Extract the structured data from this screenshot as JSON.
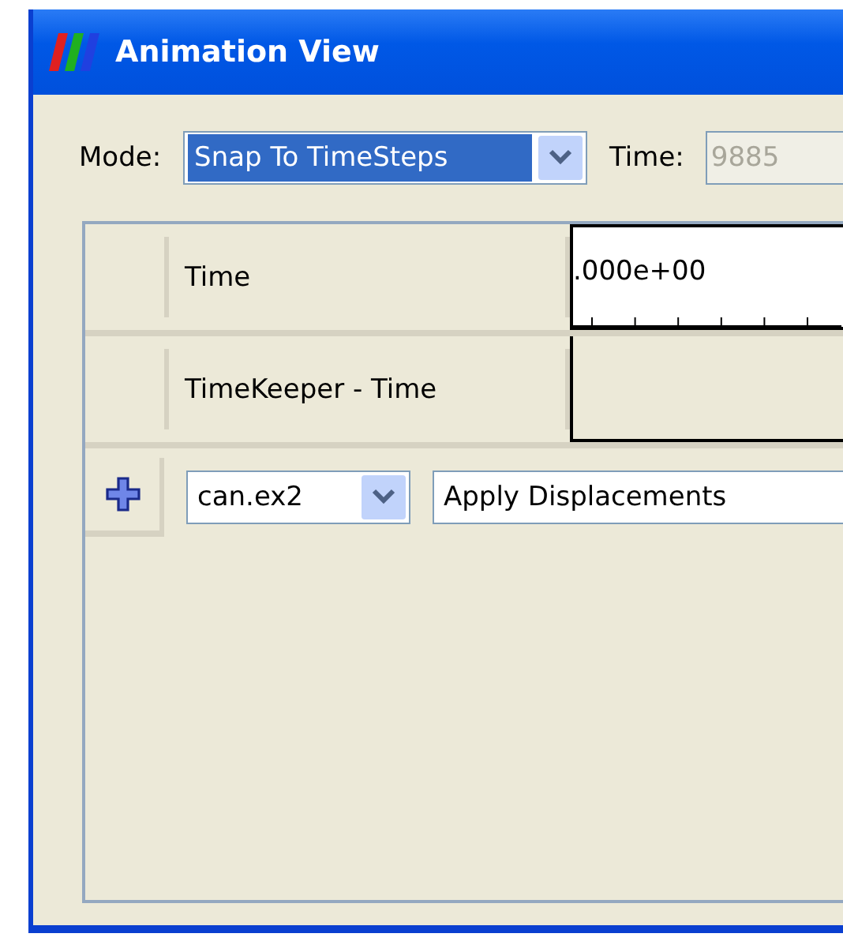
{
  "window": {
    "title": "Animation View"
  },
  "toolbar": {
    "mode_label": "Mode:",
    "mode": {
      "value": "Snap To TimeSteps",
      "selected": true
    },
    "time_label": "Time:",
    "time": {
      "value": "9885",
      "disabled": true
    }
  },
  "tracks": [
    {
      "kind": "time",
      "label": "Time",
      "value": ".000e+00"
    },
    {
      "kind": "keeper",
      "label": "TimeKeeper - Time"
    }
  ],
  "add_row": {
    "source": "can.ex2",
    "property": "Apply Displacements"
  }
}
